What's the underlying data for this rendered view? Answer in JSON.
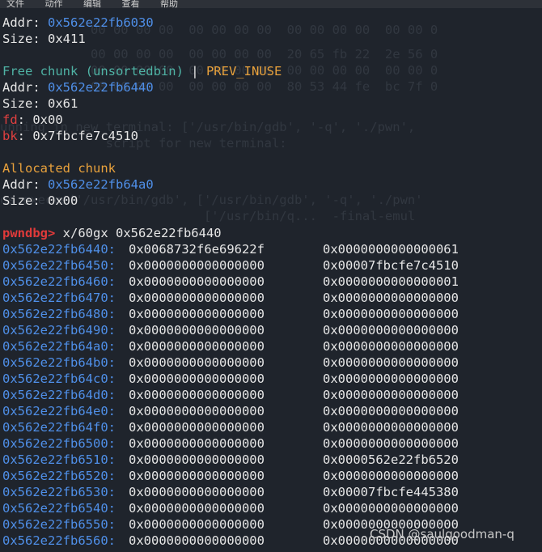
{
  "menu": [
    "文件",
    "动作",
    "编辑",
    "查看",
    "帮助"
  ],
  "chunk_header": {
    "addr_label": "Addr: ",
    "addr": "0x562e22fb6030",
    "size_label": "Size: ",
    "size": "0x411"
  },
  "free_chunk": {
    "title": "Free chunk (unsortedbin)",
    "sep": " | ",
    "flag": "PREV_INUSE",
    "addr_label": "Addr: ",
    "addr": "0x562e22fb6440",
    "size_label": "Size: ",
    "size": "0x61",
    "fd_label": "fd",
    "fd": ": 0x00",
    "bk_label": "bk",
    "bk": ": 0x7fbcfe7c4510"
  },
  "alloc_chunk": {
    "title": "Allocated chunk",
    "addr_label": "Addr: ",
    "addr": "0x562e22fb64a0",
    "size_label": "Size: ",
    "size": "0x00"
  },
  "command": {
    "prompt": "pwndbg>",
    "text": " x/60gx 0x562e22fb6440"
  },
  "memory": [
    [
      "0x562e22fb6440:",
      "0x0068732f6e69622f",
      "0x0000000000000061"
    ],
    [
      "0x562e22fb6450:",
      "0x0000000000000000",
      "0x00007fbcfe7c4510"
    ],
    [
      "0x562e22fb6460:",
      "0x0000000000000000",
      "0x0000000000000001"
    ],
    [
      "0x562e22fb6470:",
      "0x0000000000000000",
      "0x0000000000000000"
    ],
    [
      "0x562e22fb6480:",
      "0x0000000000000000",
      "0x0000000000000000"
    ],
    [
      "0x562e22fb6490:",
      "0x0000000000000000",
      "0x0000000000000000"
    ],
    [
      "0x562e22fb64a0:",
      "0x0000000000000000",
      "0x0000000000000000"
    ],
    [
      "0x562e22fb64b0:",
      "0x0000000000000000",
      "0x0000000000000000"
    ],
    [
      "0x562e22fb64c0:",
      "0x0000000000000000",
      "0x0000000000000000"
    ],
    [
      "0x562e22fb64d0:",
      "0x0000000000000000",
      "0x0000000000000000"
    ],
    [
      "0x562e22fb64e0:",
      "0x0000000000000000",
      "0x0000000000000000"
    ],
    [
      "0x562e22fb64f0:",
      "0x0000000000000000",
      "0x0000000000000000"
    ],
    [
      "0x562e22fb6500:",
      "0x0000000000000000",
      "0x0000000000000000"
    ],
    [
      "0x562e22fb6510:",
      "0x0000000000000000",
      "0x0000562e22fb6520"
    ],
    [
      "0x562e22fb6520:",
      "0x0000000000000000",
      "0x0000000000000000"
    ],
    [
      "0x562e22fb6530:",
      "0x0000000000000000",
      "0x00007fbcfe445380"
    ],
    [
      "0x562e22fb6540:",
      "0x0000000000000000",
      "0x0000000000000000"
    ],
    [
      "0x562e22fb6550:",
      "0x0000000000000000",
      "0x0000000000000000"
    ],
    [
      "0x562e22fb6560:",
      "0x0000000000000000",
      "0x0000000000000000"
    ]
  ],
  "ghost_text": [
    "            00 00 00 00  00 00 00 00  00 00 00 00  00 00 0",
    "            00 00 00 00  00 00 00 00  20 65 fb 22  2e 56 0",
    "            00 00 00 00  00 00 00 00  00 00 00 00  00 00 0",
    "            00 00 00 00  00 00 00 00  80 53 44 fe  bc 7f 0",
    "unning in new terminal: ['/usr/bin/gdb', '-q', './pwn',",
    "              script for new terminal:",
    "os.execve('/usr/bin/gdb', ['/usr/bin/gdb', '-q', './pwn'",
    "                           ['/usr/bin/q...  -final-emul"
  ],
  "watermark": "CSDN @saulgoodman-q"
}
